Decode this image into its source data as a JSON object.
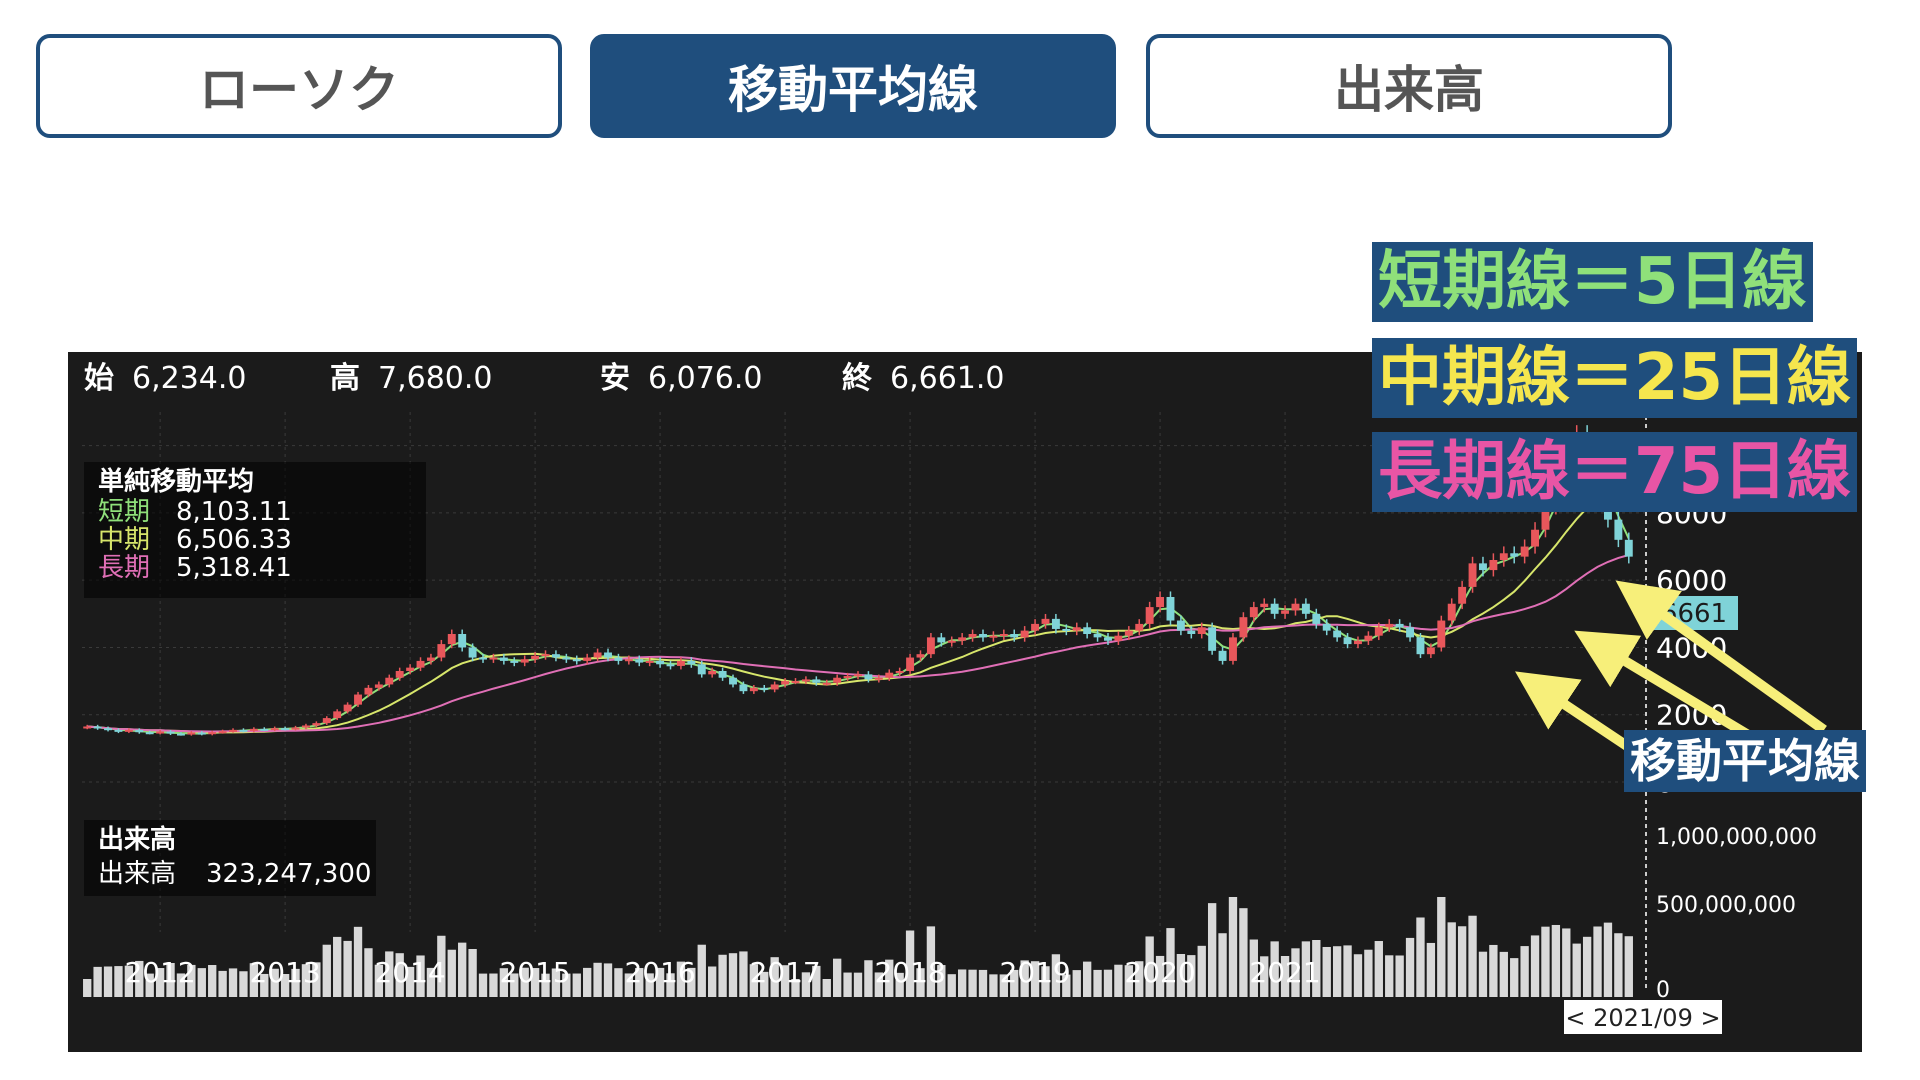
{
  "tabs": [
    {
      "label": "ローソク",
      "active": false
    },
    {
      "label": "移動平均線",
      "active": true
    },
    {
      "label": "出来高",
      "active": false
    }
  ],
  "annotations": {
    "short": "短期線＝5日線",
    "mid": "中期線＝25日線",
    "long": "長期線＝75日線",
    "ma": "移動平均線"
  },
  "ohlc": {
    "open_label": "始",
    "open": "6,234.0",
    "high_label": "高",
    "high": "7,680.0",
    "low_label": "安",
    "low": "6,076.0",
    "close_label": "終",
    "close": "6,661.0"
  },
  "ma_legend": {
    "title": "単純移動平均",
    "short_label": "短期",
    "short_value": "8,103.11",
    "mid_label": "中期",
    "mid_value": "6,506.33",
    "long_label": "長期",
    "long_value": "5,318.41"
  },
  "volume_legend": {
    "title": "出来高",
    "label": "出来高",
    "value": "323,247,300"
  },
  "current_price_label": "6661",
  "cursor_label": "< 2021/09 >",
  "colors": {
    "up": "#e8575b",
    "down": "#7fd3d8",
    "short": "#8fe07a",
    "mid": "#d7e66b",
    "long": "#e06fb6",
    "accent": "#1f4e7d",
    "arrow": "#f7ef7a"
  },
  "chart_data": {
    "type": "candlestick",
    "interval": "monthly",
    "price_axis": {
      "ticks": [
        "0",
        "2000",
        "4000",
        "6000",
        "8000",
        "10000"
      ],
      "min": 0,
      "max": 11000
    },
    "volume_axis": {
      "ticks": [
        "0",
        "500,000,000",
        "1,000,000,000"
      ],
      "min": 0,
      "max": 1000000000
    },
    "x_ticks": [
      "2012",
      "2013",
      "2014",
      "2015",
      "2016",
      "2017",
      "2018",
      "2019",
      "2020",
      "2021"
    ],
    "x_start": "2011-06",
    "x_end": "2021-09",
    "close": [
      1650,
      1600,
      1550,
      1500,
      1550,
      1480,
      1460,
      1500,
      1440,
      1420,
      1470,
      1430,
      1480,
      1510,
      1550,
      1520,
      1580,
      1560,
      1600,
      1580,
      1620,
      1680,
      1750,
      1900,
      2100,
      2300,
      2600,
      2800,
      2900,
      3100,
      3300,
      3400,
      3600,
      3700,
      4100,
      4400,
      4000,
      3700,
      3650,
      3700,
      3600,
      3550,
      3650,
      3750,
      3800,
      3700,
      3650,
      3600,
      3700,
      3850,
      3700,
      3600,
      3650,
      3550,
      3600,
      3500,
      3450,
      3600,
      3500,
      3200,
      3300,
      3100,
      2900,
      2700,
      2800,
      2750,
      2900,
      3000,
      3000,
      3050,
      2950,
      2950,
      3100,
      3150,
      3200,
      3050,
      3100,
      3250,
      3300,
      3700,
      3800,
      4300,
      4150,
      4200,
      4300,
      4400,
      4300,
      4350,
      4400,
      4300,
      4500,
      4700,
      4850,
      4550,
      4500,
      4600,
      4400,
      4300,
      4200,
      4350,
      4500,
      4700,
      5200,
      5500,
      4800,
      4500,
      4400,
      4600,
      3900,
      3600,
      4300,
      4900,
      5200,
      5300,
      5000,
      5100,
      5300,
      5000,
      4700,
      4500,
      4300,
      4100,
      4200,
      4350,
      4600,
      4700,
      4600,
      4300,
      3800,
      4000,
      4800,
      5300,
      5800,
      6500,
      6300,
      6600,
      6800,
      6700,
      7000,
      7500,
      8200,
      9000,
      9800,
      10300,
      9600,
      8700,
      7800,
      7200,
      6700
    ]
  }
}
